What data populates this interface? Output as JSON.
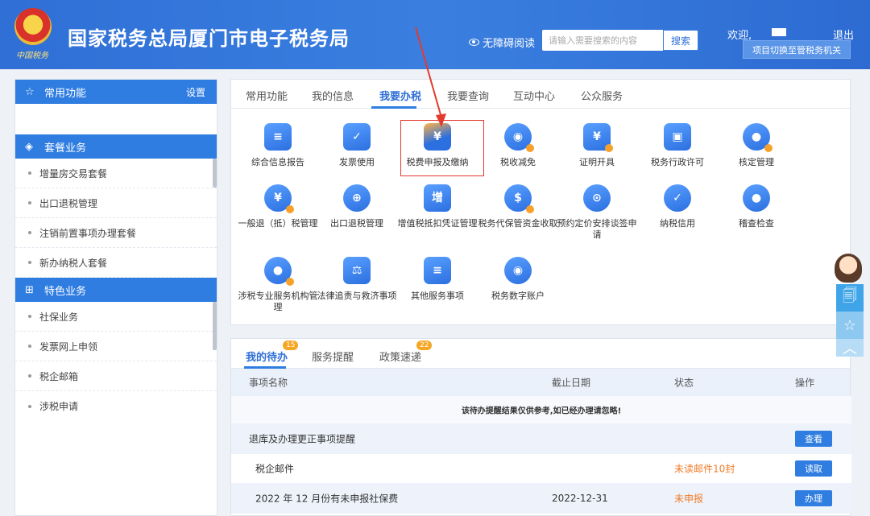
{
  "header": {
    "emblem_text": "中国税务",
    "title": "国家税务总局厦门市电子税务局",
    "accessibility": "无障碍阅读",
    "search_placeholder": "请输入需要搜索的内容",
    "search_button": "搜索",
    "welcome": "欢迎,",
    "logout": "退出",
    "switch_button": "项目切换至管税务机关"
  },
  "sidebar": {
    "common_title": "常用功能",
    "settings": "设置",
    "package_title": "套餐业务",
    "package_items": [
      "增量房交易套餐",
      "出口退税管理",
      "注销前置事项办理套餐",
      "新办纳税人套餐"
    ],
    "special_title": "特色业务",
    "special_items": [
      "社保业务",
      "发票网上申领",
      "税企邮箱",
      "涉税申请"
    ]
  },
  "main_tabs": [
    "常用功能",
    "我的信息",
    "我要办税",
    "我要查询",
    "互动中心",
    "公众服务"
  ],
  "services": [
    {
      "label": "综合信息报告",
      "icon": "clipboard-icon"
    },
    {
      "label": "发票使用",
      "icon": "ticket-icon"
    },
    {
      "label": "税费申报及缴纳",
      "icon": "yuan-wallet-icon"
    },
    {
      "label": "税收减免",
      "icon": "coin-stack-icon"
    },
    {
      "label": "证明开具",
      "icon": "certificate-icon"
    },
    {
      "label": "税务行政许可",
      "icon": "id-card-icon"
    },
    {
      "label": "核定管理",
      "icon": "user-gear-icon"
    },
    {
      "label": "一般退（抵）税管理",
      "icon": "refund-icon"
    },
    {
      "label": "出口退税管理",
      "icon": "globe-icon"
    },
    {
      "label": "增值税抵扣凭证管理",
      "icon": "vat-receipt-icon"
    },
    {
      "label": "税务代保管资金收取",
      "icon": "money-bag-icon"
    },
    {
      "label": "预约定价安排谈签申请",
      "icon": "compass-icon"
    },
    {
      "label": "纳税信用",
      "icon": "shield-check-icon"
    },
    {
      "label": "稽查检查",
      "icon": "inspector-icon"
    },
    {
      "label": "涉税专业服务机构管理",
      "icon": "agency-icon"
    },
    {
      "label": "法律追责与救济事项",
      "icon": "gavel-icon"
    },
    {
      "label": "其他服务事项",
      "icon": "list-icon"
    },
    {
      "label": "税务数字账户",
      "icon": "digital-account-icon"
    }
  ],
  "todo": {
    "tabs": [
      {
        "label": "我的待办",
        "badge": "15"
      },
      {
        "label": "服务提醒",
        "badge": ""
      },
      {
        "label": "政策速递",
        "badge": "22"
      }
    ],
    "headers": [
      "事项名称",
      "截止日期",
      "状态",
      "操作"
    ],
    "notice": "该待办提醒结果仅供参考,如已经办理请忽略!",
    "rows": [
      {
        "name": "退库及办理更正事项提醒",
        "date": "",
        "status": "",
        "action": "查看"
      },
      {
        "name": "税企邮件",
        "date": "",
        "status": "未读邮件10封",
        "action": "读取"
      },
      {
        "name": "2022 年 12 月份有未申报社保费",
        "date": "2022-12-31",
        "status": "未申报",
        "action": "办理"
      }
    ]
  },
  "colors": {
    "primary": "#2f7de1",
    "warning": "#f07c2a",
    "annotation": "#e23b2e"
  }
}
